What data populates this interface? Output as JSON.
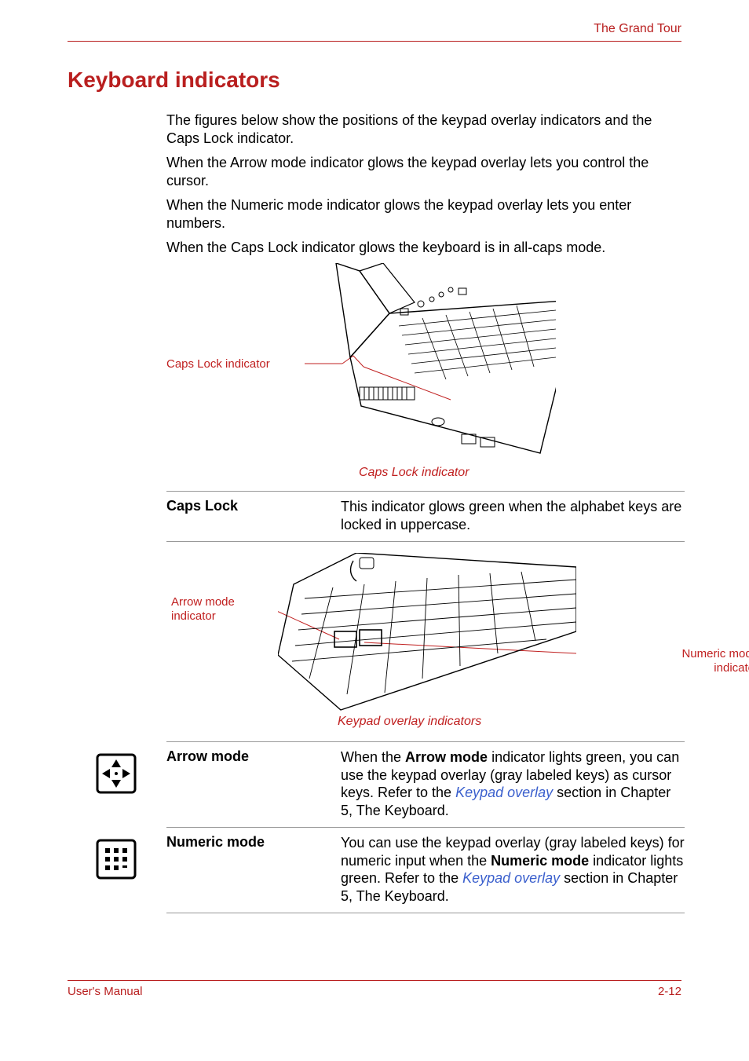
{
  "header": {
    "chapter": "The Grand Tour"
  },
  "title": "Keyboard indicators",
  "intro": [
    "The figures below show the positions of the keypad overlay indicators and the Caps Lock indicator.",
    "When the Arrow mode indicator glows the keypad overlay lets you control the cursor.",
    "When the Numeric mode indicator glows the keypad overlay lets you enter numbers.",
    "When the Caps Lock indicator glows the keyboard is in all-caps mode."
  ],
  "figure1": {
    "callout": "Caps Lock indicator",
    "caption": "Caps Lock indicator"
  },
  "def_capslock": {
    "term": "Caps Lock",
    "desc": "This indicator glows green when the alphabet keys are locked in uppercase."
  },
  "figure2": {
    "callout_left_1": "Arrow mode",
    "callout_left_2": "indicator",
    "callout_right_1": "Numeric mode",
    "callout_right_2": "indicator",
    "caption": "Keypad overlay indicators"
  },
  "def_arrow": {
    "term": "Arrow mode",
    "desc_pre": "When the ",
    "desc_bold": "Arrow mode",
    "desc_mid": " indicator lights green, you can use the keypad overlay (gray labeled keys) as cursor keys. Refer to the ",
    "link": "Keypad overlay",
    "desc_post": " section in Chapter 5, The Keyboard."
  },
  "def_numeric": {
    "term": "Numeric mode",
    "desc_pre": "You can use the keypad overlay (gray labeled keys) for numeric input when the ",
    "desc_bold": "Numeric mode",
    "desc_mid": " indicator lights green. Refer to the ",
    "link": "Keypad overlay",
    "desc_post": " section in Chapter 5, The Keyboard."
  },
  "footer": {
    "left": "User's Manual",
    "right": "2-12"
  }
}
